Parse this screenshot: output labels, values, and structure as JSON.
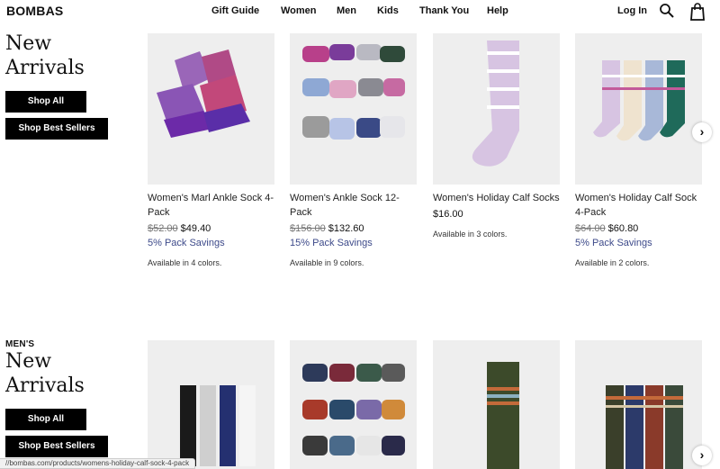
{
  "brand": "BOMBAS",
  "nav": {
    "items": [
      "Gift Guide",
      "Women",
      "Men",
      "Kids",
      "Thank You",
      "Help"
    ],
    "login": "Log In"
  },
  "icons": {
    "search": "search-icon",
    "bag": "shopping-bag-icon",
    "arrow": "chevron-right-icon"
  },
  "colors": {
    "accent": "#3d4a8a",
    "button": "#000000"
  },
  "sections": [
    {
      "eyebrow": "",
      "title_line1": "New",
      "title_line2": "Arrivals",
      "shop_all": "Shop All",
      "shop_best": "Shop Best Sellers",
      "products": [
        {
          "name": "Women's Marl Ankle Sock 4-Pack",
          "old_price": "$52.00",
          "price": "$49.40",
          "savings": "5% Pack Savings",
          "availability": "Available in 4 colors."
        },
        {
          "name": "Women's Ankle Sock 12-Pack",
          "old_price": "$156.00",
          "price": "$132.60",
          "savings": "15% Pack Savings",
          "availability": "Available in 9 colors."
        },
        {
          "name": "Women's Holiday Calf Socks",
          "old_price": "",
          "price": "$16.00",
          "savings": "",
          "availability": "Available in 3 colors."
        },
        {
          "name": "Women's Holiday Calf Sock 4-Pack",
          "old_price": "$64.00",
          "price": "$60.80",
          "savings": "5% Pack Savings",
          "availability": "Available in 2 colors."
        }
      ]
    },
    {
      "eyebrow": "MEN'S",
      "title_line1": "New",
      "title_line2": "Arrivals",
      "shop_all": "Shop All",
      "shop_best": "Shop Best Sellers"
    }
  ],
  "status_url": "//bombas.com/products/womens-holiday-calf-sock-4-pack"
}
